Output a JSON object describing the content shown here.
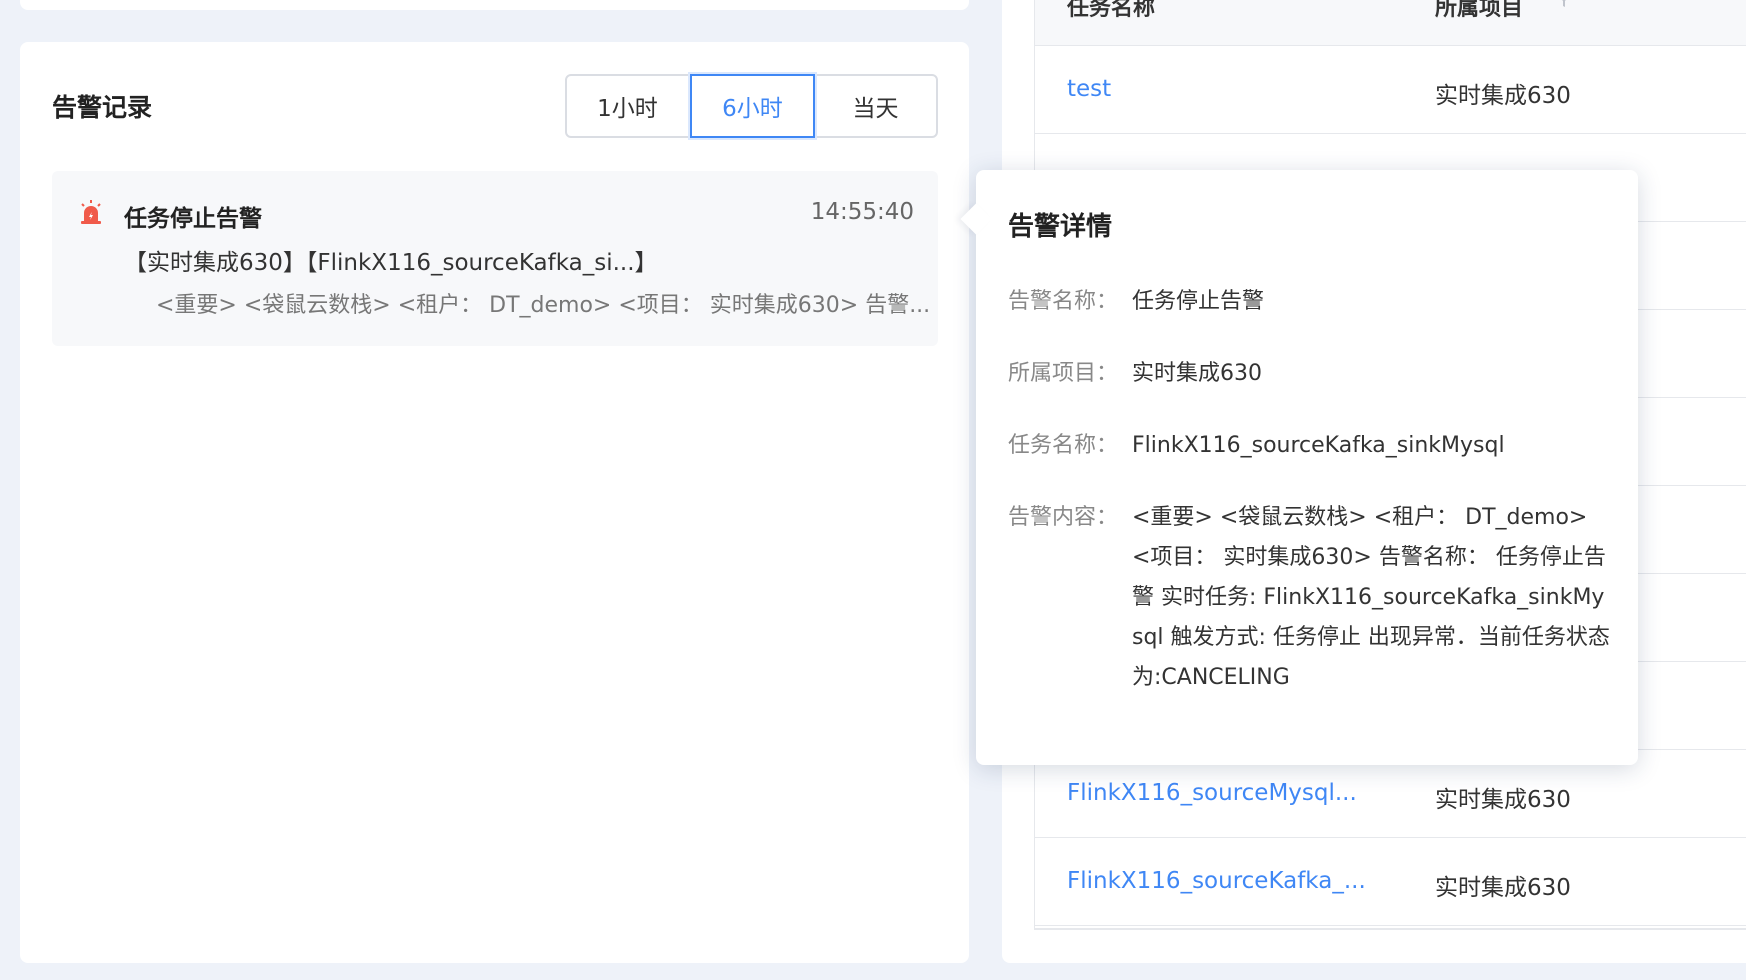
{
  "alert_panel": {
    "title": "告警记录",
    "time_filters": [
      "1小时",
      "6小时",
      "当天"
    ],
    "active_filter": "6小时",
    "card": {
      "title": "任务停止告警",
      "time": "14:55:40",
      "line2": "【实时集成630】【FlinkX116_sourceKafka_si...】",
      "line3": "<重要> <袋鼠云数栈> <租户： DT_demo> <项目： 实时集成630> 告警..."
    }
  },
  "table": {
    "headers": {
      "task": "任务名称",
      "project": "所属项目"
    },
    "rows": [
      {
        "task": "test",
        "project": "实时集成630"
      },
      {
        "task": "",
        "project": ""
      },
      {
        "task": "",
        "project": ""
      },
      {
        "task": "",
        "project": ""
      },
      {
        "task": "",
        "project": ""
      },
      {
        "task": "",
        "project": ""
      },
      {
        "task": "",
        "project": ""
      },
      {
        "task": "",
        "project": ""
      },
      {
        "task": "FlinkX116_sourceMysql...",
        "project": "实时集成630"
      },
      {
        "task": "FlinkX116_sourceKafka_...",
        "project": "实时集成630"
      }
    ]
  },
  "popover": {
    "title": "告警详情",
    "fields": [
      {
        "label": "告警名称：",
        "value": "任务停止告警"
      },
      {
        "label": "所属项目：",
        "value": "实时集成630"
      },
      {
        "label": "任务名称：",
        "value": "FlinkX116_sourceKafka_sinkMysql"
      },
      {
        "label": "告警内容：",
        "value": "<重要> <袋鼠云数栈> <租户： DT_demo> <项目： 实时集成630> 告警名称： 任务停止告警 实时任务: FlinkX116_sourceKafka_sinkMysql 触发方式: 任务停止 出现异常．当前任务状态为:CANCELING"
      }
    ]
  },
  "colors": {
    "accent": "#3f87f5",
    "alarm": "#f05a4a"
  }
}
